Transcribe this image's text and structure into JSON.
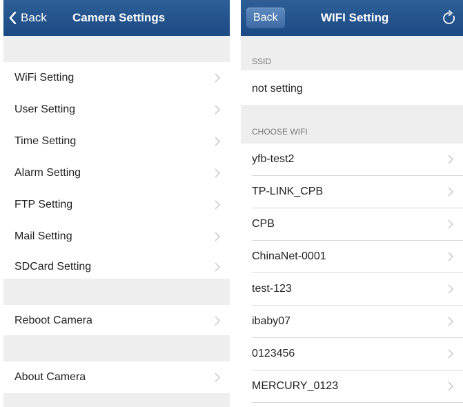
{
  "left": {
    "back_label": "Back",
    "title": "Camera Settings",
    "menu_items": [
      {
        "label": "WiFi Setting"
      },
      {
        "label": "User Setting"
      },
      {
        "label": "Time Setting"
      },
      {
        "label": "Alarm Setting"
      },
      {
        "label": "FTP Setting"
      },
      {
        "label": "Mail Setting"
      },
      {
        "label": "SDCard Setting"
      }
    ],
    "reboot_label": "Reboot Camera",
    "about_label": "About Camera"
  },
  "right": {
    "back_label": "Back",
    "title": "WIFI Setting",
    "ssid_header": "SSID",
    "ssid_value": "not setting",
    "choose_header": "CHOOSE WIFI",
    "networks": [
      {
        "name": "yfb-test2"
      },
      {
        "name": "TP-LINK_CPB"
      },
      {
        "name": "CPB"
      },
      {
        "name": "ChinaNet-0001"
      },
      {
        "name": "test-123"
      },
      {
        "name": "ibaby07"
      },
      {
        "name": "0123456"
      },
      {
        "name": "MERCURY_0123"
      }
    ]
  },
  "colors": {
    "navbar": "#2f5f97",
    "group_background": "#eeeeee",
    "row_background": "#ffffff",
    "text": "#222222",
    "header_text": "#777777"
  }
}
